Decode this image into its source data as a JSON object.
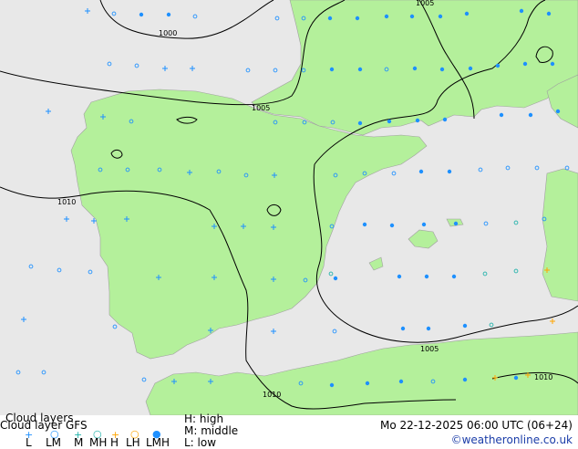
{
  "colors": {
    "sea": "#e8e8e8",
    "land": "#b4f09b",
    "coast": "#a0a0a0",
    "isobar": "#000000",
    "high": "#1e90ff",
    "middle": "#20b2aa",
    "low": "#ffa500",
    "lmh": "#1e90ff"
  },
  "isobars": [
    {
      "label": "1000"
    },
    {
      "label": "1005"
    },
    {
      "label": "1010"
    },
    {
      "label": "1005"
    },
    {
      "label": "1010"
    },
    {
      "label": "1005"
    },
    {
      "label": "1010"
    }
  ],
  "legend": {
    "title": "Cloud layers",
    "subtitle": "Cloud layer  GFS",
    "symbols": [
      {
        "code": "L",
        "icon": "plus",
        "color": "#1e90ff"
      },
      {
        "code": "LM",
        "icon": "circle-small",
        "color": "#1e90ff"
      },
      {
        "code": "M",
        "icon": "plus",
        "color": "#20b2aa"
      },
      {
        "code": "MH",
        "icon": "circle-small",
        "color": "#20b2aa"
      },
      {
        "code": "H",
        "icon": "plus",
        "color": "#ffa500"
      },
      {
        "code": "LH",
        "icon": "circle-small",
        "color": "#ffa500"
      },
      {
        "code": "LMH",
        "icon": "filled-dot",
        "color": "#1e90ff"
      }
    ],
    "key": [
      {
        "text": "H: high"
      },
      {
        "text": "M: middle"
      },
      {
        "text": "L: low"
      }
    ],
    "datetime": "Mo 22-12-2025 06:00 UTC (06+24)",
    "credit": "©weatheronline.co.uk"
  }
}
